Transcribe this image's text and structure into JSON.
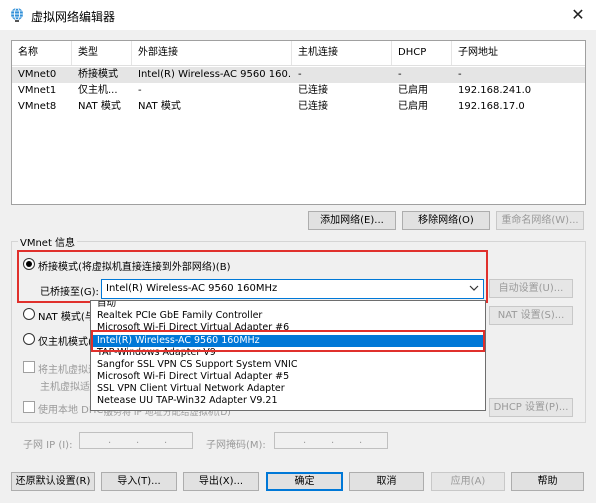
{
  "window": {
    "title": "虚拟网络编辑器",
    "close_glyph": "✕"
  },
  "table": {
    "columns": [
      "名称",
      "类型",
      "外部连接",
      "主机连接",
      "DHCP",
      "子网地址"
    ],
    "rows": [
      [
        "VMnet0",
        "桥接模式",
        "Intel(R) Wireless-AC 9560 160...",
        "-",
        "-",
        "-"
      ],
      [
        "VMnet1",
        "仅主机...",
        "-",
        "已连接",
        "已启用",
        "192.168.241.0"
      ],
      [
        "VMnet8",
        "NAT 模式",
        "NAT 模式",
        "已连接",
        "已启用",
        "192.168.17.0"
      ]
    ],
    "selected_index": 0
  },
  "network_buttons": {
    "add": "添加网络(E)...",
    "remove": "移除网络(O)",
    "rename": "重命名网络(W)..."
  },
  "vmnet_info": {
    "group_title": "VMnet 信息",
    "bridge_radio": "桥接模式(将虚拟机直接连接到外部网络)(B)",
    "bridged_to_label": "已桥接至(G):",
    "bridged_to_value": "Intel(R) Wireless-AC 9560 160MHz",
    "auto_settings": "自动设置(U)...",
    "nat_radio": "NAT 模式(与虚",
    "nat_settings": "NAT 设置(S)...",
    "host_only_radio": "仅主机模式(在",
    "connect_host_check": "将主机虚拟适配",
    "host_adapter_name_label": "主机虚拟适配",
    "dhcp_check": "使用本地 DHCP",
    "dhcp_check_tail": "服务将 IP 地址分配给虚拟机(D)",
    "dhcp_settings": "DHCP 设置(P)...",
    "subnet_ip_label": "子网 IP (I):",
    "subnet_mask_label": "子网掩码(M):"
  },
  "dropdown": {
    "items": [
      "自动",
      "Realtek PCIe GbE Family Controller",
      "Microsoft Wi-Fi Direct Virtual Adapter #6",
      "Intel(R) Wireless-AC 9560 160MHz",
      "TAP-Windows Adapter V9",
      "Sangfor SSL VPN CS Support System VNIC",
      "Microsoft Wi-Fi Direct Virtual Adapter #5",
      "SSL VPN Client Virtual Network Adapter",
      "Netease UU TAP-Win32 Adapter V9.21"
    ],
    "highlighted_index": 3
  },
  "footer_buttons": {
    "restore": "还原默认设置(R)",
    "import": "导入(T)...",
    "export": "导出(X)...",
    "ok": "确定",
    "cancel": "取消",
    "apply": "应用(A)",
    "help": "帮助"
  },
  "colors": {
    "highlight": "#0078d7",
    "annotation": "#e0302c",
    "selected_row": "#e5e5e5"
  }
}
